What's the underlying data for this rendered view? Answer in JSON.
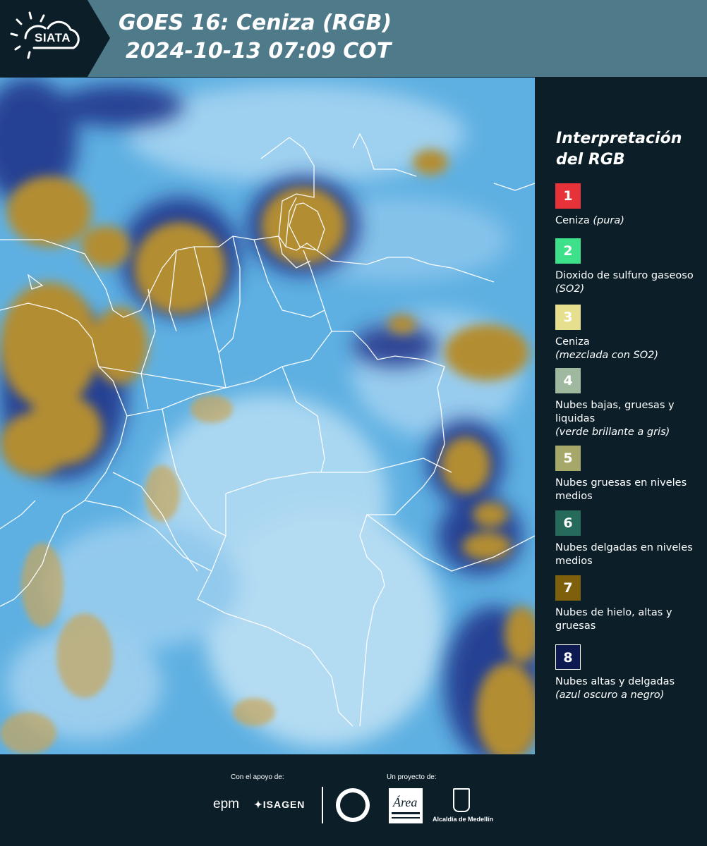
{
  "header": {
    "brand": "SIATA",
    "title": "GOES 16: Ceniza (RGB)",
    "datetime": "2024-10-13 07:09 COT",
    "bar_color": "#4f7a8a",
    "logo_box_color": "#0c1f29"
  },
  "legend": {
    "title_line1": "Interpretación",
    "title_line2": "del RGB",
    "items": [
      {
        "num": "1",
        "color": "#e8323a",
        "label": "Ceniza",
        "note": "(pura)",
        "note_inline": true
      },
      {
        "num": "2",
        "color": "#3fe08a",
        "label": "Dioxido de sulfuro gaseoso",
        "note": "(SO2)",
        "note_inline": true
      },
      {
        "num": "3",
        "color": "#e6e08e",
        "label": "Ceniza",
        "note": "(mezclada con SO2)",
        "note_inline": false
      },
      {
        "num": "4",
        "color": "#9fb8a0",
        "label": "Nubes bajas, gruesas y liquidas",
        "note": "(verde brillante a gris)",
        "note_inline": false
      },
      {
        "num": "5",
        "color": "#a6a86a",
        "label": "Nubes gruesas en niveles medios",
        "note": "",
        "note_inline": false
      },
      {
        "num": "6",
        "color": "#256a5a",
        "label": "Nubes delgadas en niveles medios",
        "note": "",
        "note_inline": false
      },
      {
        "num": "7",
        "color": "#7d5f0c",
        "label": "Nubes de hielo, altas y gruesas",
        "note": "",
        "note_inline": false
      },
      {
        "num": "8",
        "color": "#0d1a52",
        "label": "Nubes altas y delgadas",
        "note": "(azul oscuro a negro)",
        "note_inline": false
      }
    ]
  },
  "footer": {
    "support_label": "Con el apoyo de:",
    "project_label": "Un proyecto de:",
    "sponsors": [
      "epm",
      "ISAGEN"
    ],
    "partners": [
      "Área Metropolitana Valle de Aburrá",
      "Alcaldía de Medellín"
    ]
  },
  "map": {
    "ocean_colors": [
      "#4fa6dd",
      "#7fc4ec",
      "#a9d8f3"
    ],
    "ice_cloud_color": "#b58f35",
    "thin_cloud_color": "#1c2d86",
    "border_color": "#ffffff"
  }
}
